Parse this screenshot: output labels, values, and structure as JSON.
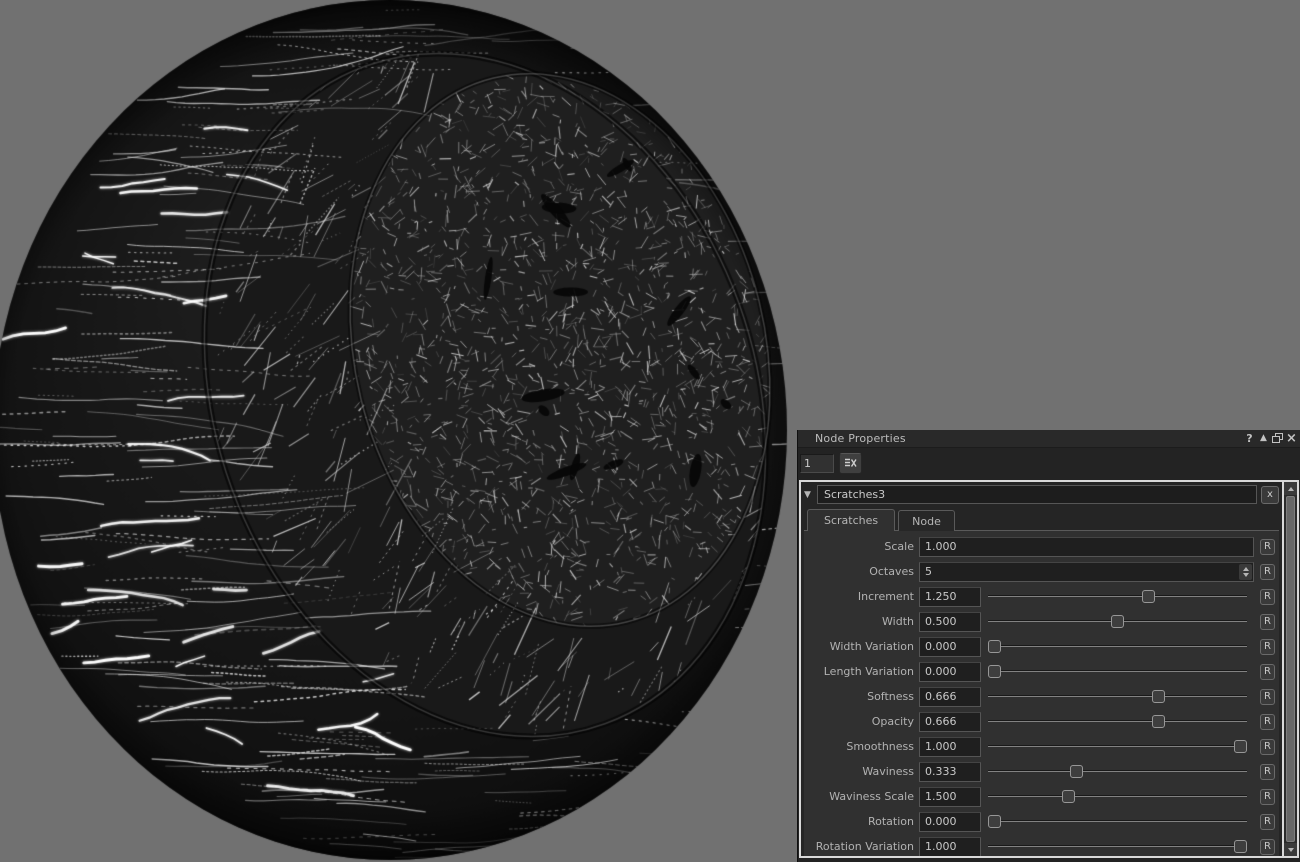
{
  "viewport": {
    "description": "3D preview sphere with procedural scratches texture",
    "background_color": "#717171"
  },
  "panel": {
    "title": "Node Properties",
    "titlebar_icons": [
      {
        "name": "help-icon",
        "glyph": "?"
      },
      {
        "name": "dock-icon",
        "glyph": "▲"
      },
      {
        "name": "float-icon",
        "glyph": ""
      },
      {
        "name": "close-icon",
        "glyph": "×"
      }
    ],
    "max_panels_value": "1",
    "clear_panels_button": "clear-all-panels"
  },
  "node": {
    "name": "Scratches3",
    "collapse_glyph": "▼",
    "close_label": "x",
    "reset_label": "R",
    "tabs": [
      {
        "label": "Scratches",
        "active": true
      },
      {
        "label": "Node",
        "active": false
      }
    ],
    "parameters": [
      {
        "label": "Scale",
        "value": "1.000",
        "control": "text"
      },
      {
        "label": "Octaves",
        "value": "5",
        "control": "spinner"
      },
      {
        "label": "Increment",
        "value": "1.250",
        "control": "slider",
        "fraction": 0.625
      },
      {
        "label": "Width",
        "value": "0.500",
        "control": "slider",
        "fraction": 0.5
      },
      {
        "label": "Width Variation",
        "value": "0.000",
        "control": "slider",
        "fraction": 0.0
      },
      {
        "label": "Length Variation",
        "value": "0.000",
        "control": "slider",
        "fraction": 0.0
      },
      {
        "label": "Softness",
        "value": "0.666",
        "control": "slider",
        "fraction": 0.666
      },
      {
        "label": "Opacity",
        "value": "0.666",
        "control": "slider",
        "fraction": 0.666
      },
      {
        "label": "Smoothness",
        "value": "1.000",
        "control": "slider",
        "fraction": 1.0
      },
      {
        "label": "Waviness",
        "value": "0.333",
        "control": "slider",
        "fraction": 0.333
      },
      {
        "label": "Waviness Scale",
        "value": "1.500",
        "control": "slider",
        "fraction": 0.3
      },
      {
        "label": "Rotation",
        "value": "0.000",
        "control": "slider",
        "fraction": 0.0
      },
      {
        "label": "Rotation Variation",
        "value": "1.000",
        "control": "slider",
        "fraction": 1.0
      }
    ]
  },
  "colors": {
    "viewport_bg": "#717171",
    "panel_bg": "#232323",
    "titlebar_bg": "#292929",
    "content_bg": "#303030",
    "field_bg": "#1f1f1f",
    "focus_border": "#d9d9d9",
    "text": "#c8c8c8"
  }
}
